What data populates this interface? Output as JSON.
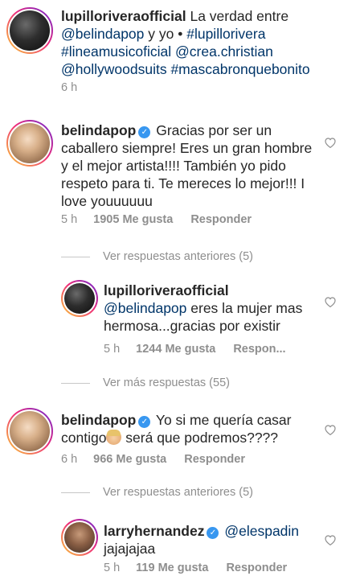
{
  "caption": {
    "username": "lupilloriveraofficial",
    "text_before": " La verdad entre ",
    "mention1": "@belindapop",
    "text_mid": " y yo • ",
    "tag1": "#lupillorivera",
    "tag2": "#lineamusicoficial",
    "mention2": "@crea.christian",
    "mention3": "@hollywoodsuits",
    "tag3": "#mascabronquebonito",
    "time": "6 h"
  },
  "comments": [
    {
      "username": "belindapop",
      "verified": true,
      "text": "Gracias por ser un caballero siempre! Eres un gran hombre y el mejor artista!!!! También yo pido respeto para ti. Te mereces lo mejor!!! I love youuuuuu",
      "time": "5 h",
      "likes": "1905 Me gusta",
      "reply": "Responder"
    },
    {
      "view_replies": "Ver respuestas anteriores (5)"
    },
    {
      "username": "lupilloriveraofficial",
      "mention": "@belindapop",
      "text": " eres la mujer mas hermosa...gracias por existir",
      "time": "5 h",
      "likes": "1244 Me gusta",
      "reply": "Respon..."
    },
    {
      "view_replies": "Ver más respuestas (55)"
    },
    {
      "username": "belindapop",
      "verified": true,
      "text_before": "Yo si me quería casar contigo",
      "text_after": " será que podremos????",
      "time": "6 h",
      "likes": "966 Me gusta",
      "reply": "Responder"
    },
    {
      "view_replies": "Ver respuestas anteriores (5)"
    },
    {
      "username": "larryhernandez",
      "verified": true,
      "mention": "@elespadin",
      "text": "jajajajaa",
      "time": "5 h",
      "likes": "119 Me gusta",
      "reply": "Responder"
    }
  ],
  "icons": {
    "heart": "heart-outline-icon",
    "verified": "verified-badge-icon",
    "emoji": "woman-emoji-icon"
  },
  "colors": {
    "text": "#262626",
    "mention": "#003569",
    "meta": "#8e8e8e",
    "verified": "#3897f0"
  }
}
